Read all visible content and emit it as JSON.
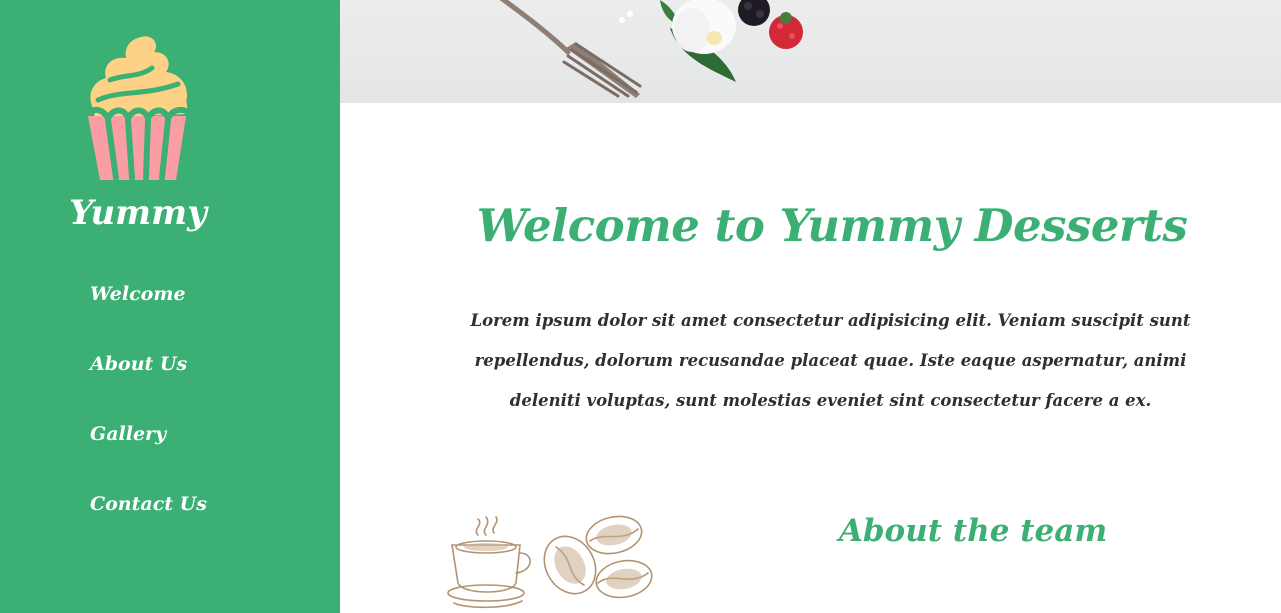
{
  "brand": {
    "name": "Yummy"
  },
  "nav": {
    "items": [
      {
        "label": "Welcome"
      },
      {
        "label": "About Us"
      },
      {
        "label": "Gallery"
      },
      {
        "label": "Contact Us"
      }
    ]
  },
  "welcome": {
    "title": "Welcome to Yummy Desserts",
    "text": "Lorem ipsum dolor sit amet consectetur adipisicing elit. Veniam suscipit sunt repellendus, dolorum recusandae placeat quae. Iste eaque aspernatur, animi deleniti voluptas, sunt molestias eveniet sint consectetur facere a ex."
  },
  "about": {
    "title": "About the team"
  },
  "colors": {
    "primary": "#3cb074",
    "text": "#2f2f2f",
    "cupcake_frosting": "#fdd186",
    "cupcake_wrapper": "#fb9ea4"
  },
  "icons": {
    "logo": "cupcake-icon",
    "coffee": "coffee-beans-icon",
    "hero": "dessert-photo"
  }
}
